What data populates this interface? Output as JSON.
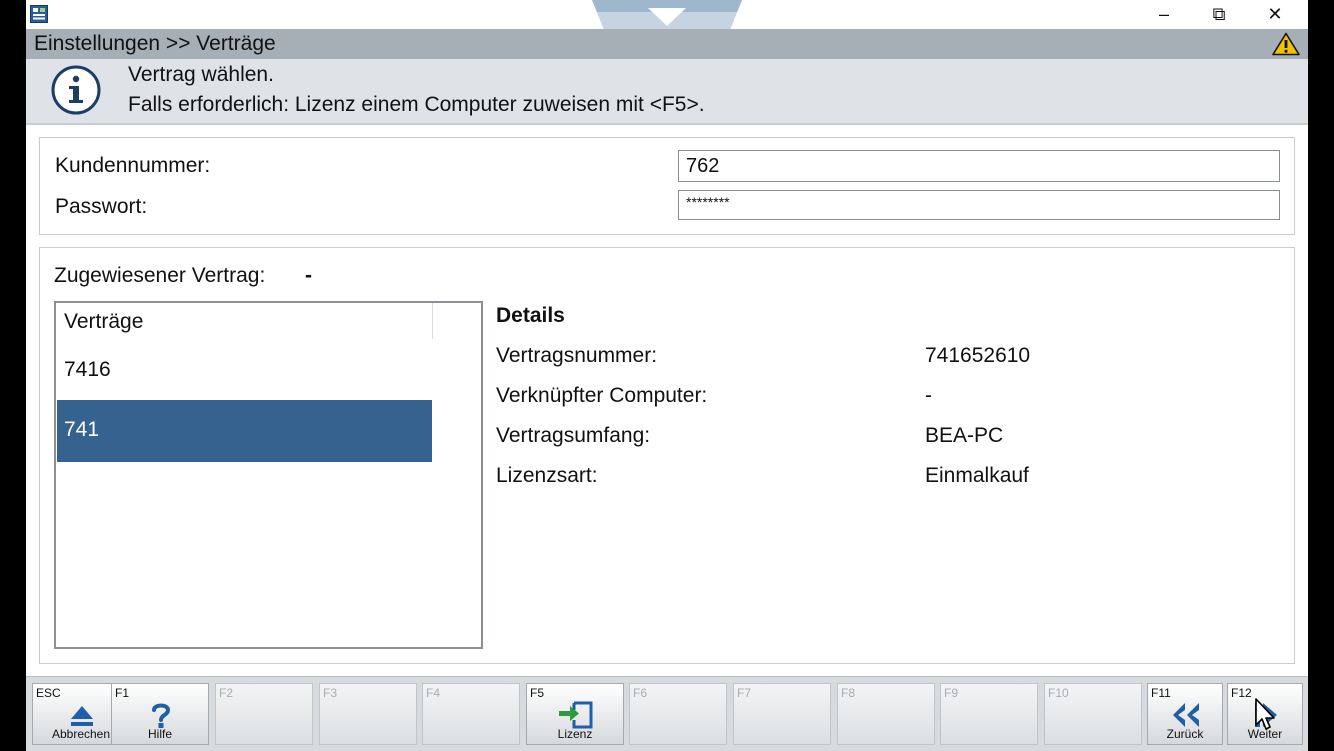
{
  "window": {
    "controls": {
      "minimize": "–",
      "maximize": "⧉",
      "close": "✕"
    }
  },
  "header": {
    "breadcrumb": "Einstellungen >> Verträge",
    "warning_icon": "warning-icon"
  },
  "info": {
    "icon": "info-icon",
    "line1": "Vertrag wählen.",
    "line2": "Falls erforderlich: Lizenz einem Computer zuweisen mit <F5>."
  },
  "credentials": {
    "customer_number_label": "Kundennummer:",
    "customer_number_value": "762",
    "password_label": "Passwort:",
    "password_value": "********"
  },
  "contract": {
    "assigned_label": "Zugewiesener Vertrag:",
    "assigned_value": "-",
    "list": {
      "header": "Verträge",
      "items": [
        {
          "label": "7416",
          "selected": false
        },
        {
          "label": "741",
          "selected": true
        }
      ]
    },
    "details": {
      "title": "Details",
      "rows": [
        {
          "label": "Vertragsnummer:",
          "value": "741652610"
        },
        {
          "label": "Verknüpfter Computer:",
          "value": "-"
        },
        {
          "label": "Vertragsumfang:",
          "value": "BEA-PC"
        },
        {
          "label": "Lizenzsart:",
          "value": "Einmalkauf"
        }
      ]
    }
  },
  "function_keys": [
    {
      "key": "ESC",
      "label": "Abbrechen",
      "icon": "eject-icon",
      "enabled": true
    },
    {
      "key": "F1",
      "label": "Hilfe",
      "icon": "help-icon",
      "enabled": true
    },
    {
      "key": "F2",
      "label": "",
      "enabled": false
    },
    {
      "key": "F3",
      "label": "",
      "enabled": false
    },
    {
      "key": "F4",
      "label": "",
      "enabled": false
    },
    {
      "key": "F5",
      "label": "Lizenz",
      "icon": "license-assign-icon",
      "enabled": true
    },
    {
      "key": "F6",
      "label": "",
      "enabled": false
    },
    {
      "key": "F7",
      "label": "",
      "enabled": false
    },
    {
      "key": "F8",
      "label": "",
      "enabled": false
    },
    {
      "key": "F9",
      "label": "",
      "enabled": false
    },
    {
      "key": "F10",
      "label": "",
      "enabled": false
    },
    {
      "key": "F11",
      "label": "Zurück",
      "icon": "double-chevron-left-icon",
      "enabled": true
    },
    {
      "key": "F12",
      "label": "Weiter",
      "icon": "next-icon",
      "enabled": true
    }
  ],
  "colors": {
    "header_bg": "#a6aeb6",
    "info_bg": "#dfe3e7",
    "selection": "#36628f",
    "accent_blue": "#1f5fa8",
    "accent_green": "#2e9b3a"
  }
}
